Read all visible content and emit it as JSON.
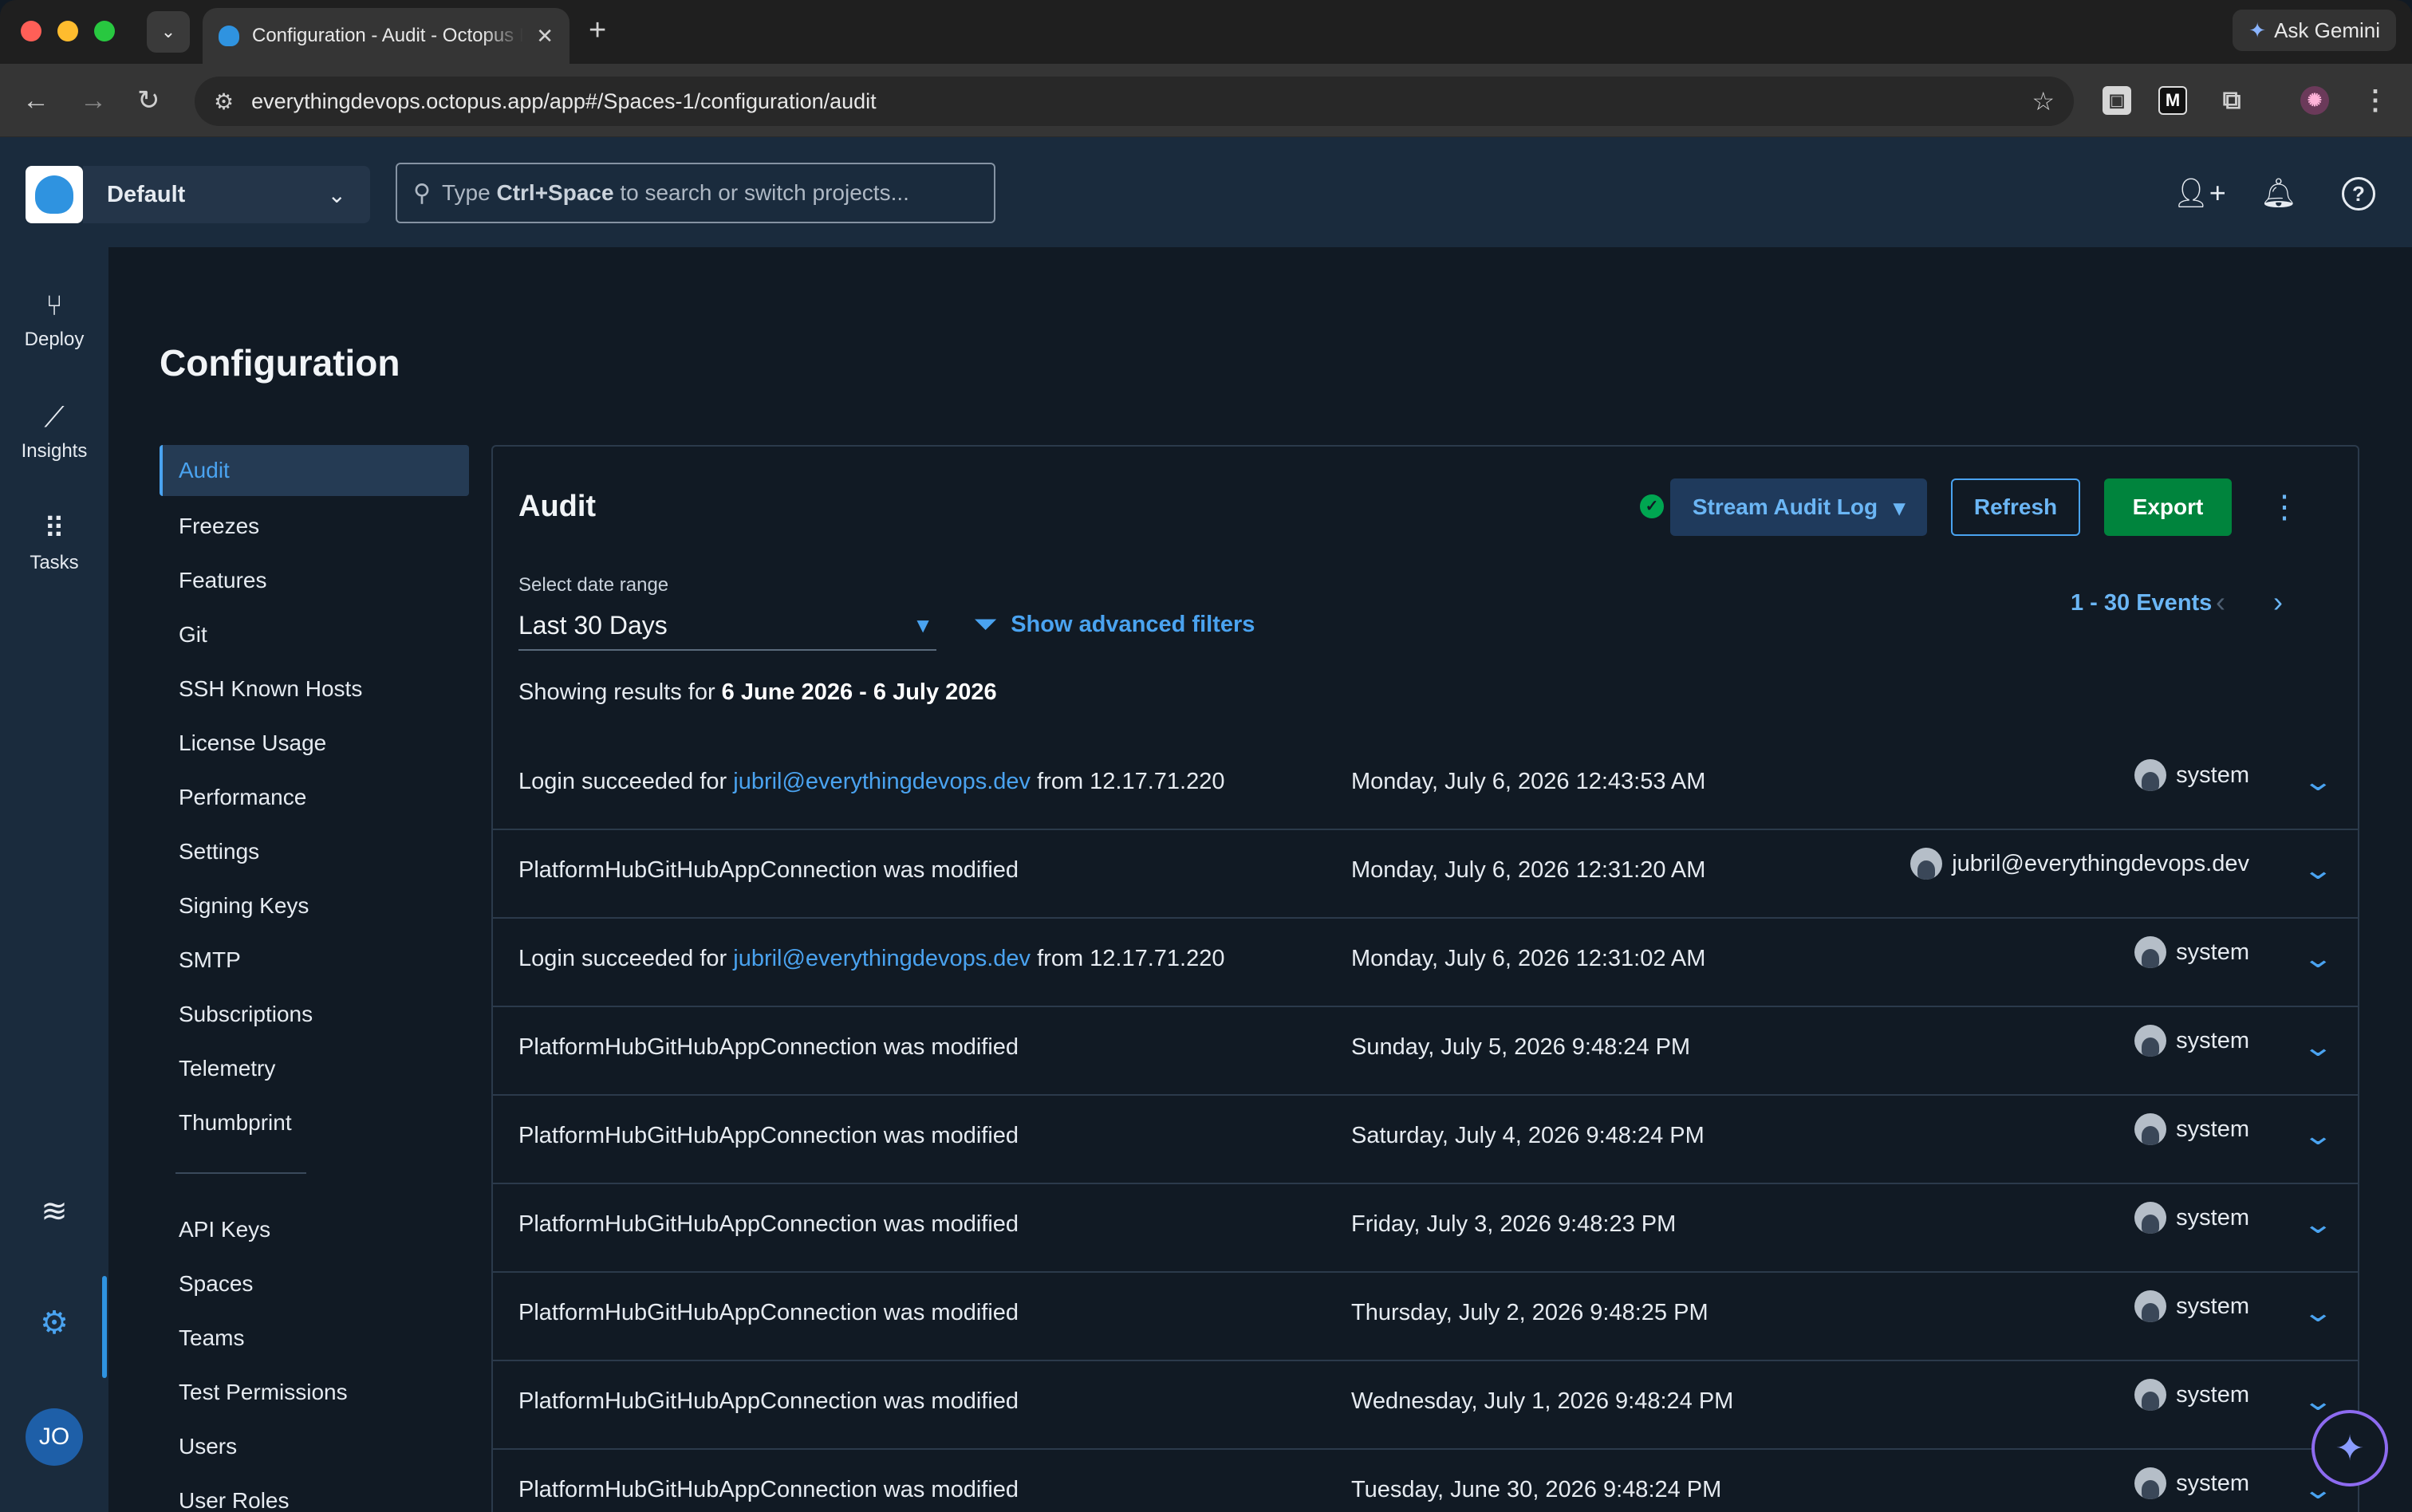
{
  "browser": {
    "tab_title": "Configuration - Audit - Octopus Deploy",
    "new_tab": "+",
    "close_tab": "✕",
    "ask_gemini": "Ask Gemini",
    "url": "everythingdevops.octopus.app/app#/Spaces-1/configuration/audit"
  },
  "header": {
    "space_name": "Default",
    "search_prefix": "Type ",
    "search_shortcut": "Ctrl+Space",
    "search_suffix": " to search or switch projects..."
  },
  "rail": {
    "items": [
      {
        "label": "Deploy",
        "icon": "deploy-icon"
      },
      {
        "label": "Insights",
        "icon": "insights-icon"
      },
      {
        "label": "Tasks",
        "icon": "tasks-icon"
      }
    ],
    "avatar_initials": "JO"
  },
  "page": {
    "title": "Configuration"
  },
  "subnav": {
    "primary": [
      "Audit",
      "Freezes",
      "Features",
      "Git",
      "SSH Known Hosts",
      "License Usage",
      "Performance",
      "Settings",
      "Signing Keys",
      "SMTP",
      "Subscriptions",
      "Telemetry",
      "Thumbprint"
    ],
    "secondary": [
      "API Keys",
      "Spaces",
      "Teams",
      "Test Permissions",
      "Users",
      "User Roles"
    ],
    "active": "Audit"
  },
  "audit": {
    "title": "Audit",
    "stream_label": "Stream Audit Log",
    "refresh_label": "Refresh",
    "export_label": "Export",
    "date_range_label": "Select date range",
    "date_range_value": "Last 30 Days",
    "advanced_filters_label": "Show advanced filters",
    "events_count": "1 - 30 Events",
    "showing_prefix": "Showing results for ",
    "showing_range": "6 June 2026 - 6 July 2026",
    "rows": [
      {
        "pre": "Login succeeded for ",
        "link": "jubril@everythingdevops.dev",
        "post": " from 12.17.71.220",
        "date": "Monday, July 6, 2026 12:43:53 AM",
        "user": "system"
      },
      {
        "pre": "PlatformHubGitHubAppConnection was modified",
        "link": "",
        "post": "",
        "date": "Monday, July 6, 2026 12:31:20 AM",
        "user": "jubril@everythingdevops.dev"
      },
      {
        "pre": "Login succeeded for ",
        "link": "jubril@everythingdevops.dev",
        "post": " from 12.17.71.220",
        "date": "Monday, July 6, 2026 12:31:02 AM",
        "user": "system"
      },
      {
        "pre": "PlatformHubGitHubAppConnection was modified",
        "link": "",
        "post": "",
        "date": "Sunday, July 5, 2026 9:48:24 PM",
        "user": "system"
      },
      {
        "pre": "PlatformHubGitHubAppConnection was modified",
        "link": "",
        "post": "",
        "date": "Saturday, July 4, 2026 9:48:24 PM",
        "user": "system"
      },
      {
        "pre": "PlatformHubGitHubAppConnection was modified",
        "link": "",
        "post": "",
        "date": "Friday, July 3, 2026 9:48:23 PM",
        "user": "system"
      },
      {
        "pre": "PlatformHubGitHubAppConnection was modified",
        "link": "",
        "post": "",
        "date": "Thursday, July 2, 2026 9:48:25 PM",
        "user": "system"
      },
      {
        "pre": "PlatformHubGitHubAppConnection was modified",
        "link": "",
        "post": "",
        "date": "Wednesday, July 1, 2026 9:48:24 PM",
        "user": "system"
      },
      {
        "pre": "PlatformHubGitHubAppConnection was modified",
        "link": "",
        "post": "",
        "date": "Tuesday, June 30, 2026 9:48:24 PM",
        "user": "system"
      }
    ]
  },
  "colors": {
    "accent": "#4aa3f0",
    "export_green": "#00843d",
    "header_bg": "#1a2b3d",
    "page_bg": "#111a24"
  }
}
